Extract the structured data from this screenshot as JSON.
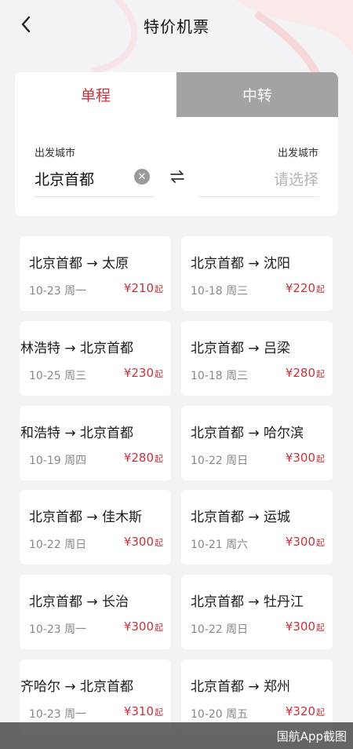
{
  "header": {
    "title": "特价机票"
  },
  "tabs": {
    "single": "单程",
    "transfer": "中转"
  },
  "search": {
    "from_label": "出发城市",
    "from_value": "北京首都",
    "to_label": "出发城市",
    "to_placeholder": "请选择"
  },
  "deals": [
    {
      "route": "北京首都 → 太原",
      "date": "10-23 周一",
      "price": "¥210",
      "suffix": "起"
    },
    {
      "route": "北京首都 → 沈阳",
      "date": "10-18 周三",
      "price": "¥220",
      "suffix": "起"
    },
    {
      "route": "锡林浩特 → 北京首都",
      "date": "10-25 周三",
      "price": "¥230",
      "suffix": "起"
    },
    {
      "route": "北京首都 → 吕梁",
      "date": "10-18 周三",
      "price": "¥280",
      "suffix": "起"
    },
    {
      "route": "呼和浩特 → 北京首都",
      "date": "10-19 周四",
      "price": "¥280",
      "suffix": "起"
    },
    {
      "route": "北京首都 → 哈尔滨",
      "date": "10-22 周日",
      "price": "¥300",
      "suffix": "起"
    },
    {
      "route": "北京首都 → 佳木斯",
      "date": "10-22 周日",
      "price": "¥300",
      "suffix": "起"
    },
    {
      "route": "北京首都 → 运城",
      "date": "10-21 周六",
      "price": "¥300",
      "suffix": "起"
    },
    {
      "route": "北京首都 → 长治",
      "date": "10-23 周一",
      "price": "¥300",
      "suffix": "起"
    },
    {
      "route": "北京首都 → 牡丹江",
      "date": "10-22 周日",
      "price": "¥300",
      "suffix": "起"
    },
    {
      "route": "齐齐哈尔 → 北京首都",
      "date": "10-23 周一",
      "price": "¥310",
      "suffix": "起"
    },
    {
      "route": "北京首都 → 郑州",
      "date": "10-20 周五",
      "price": "¥320",
      "suffix": "起"
    }
  ],
  "watermark": "国航App截图"
}
